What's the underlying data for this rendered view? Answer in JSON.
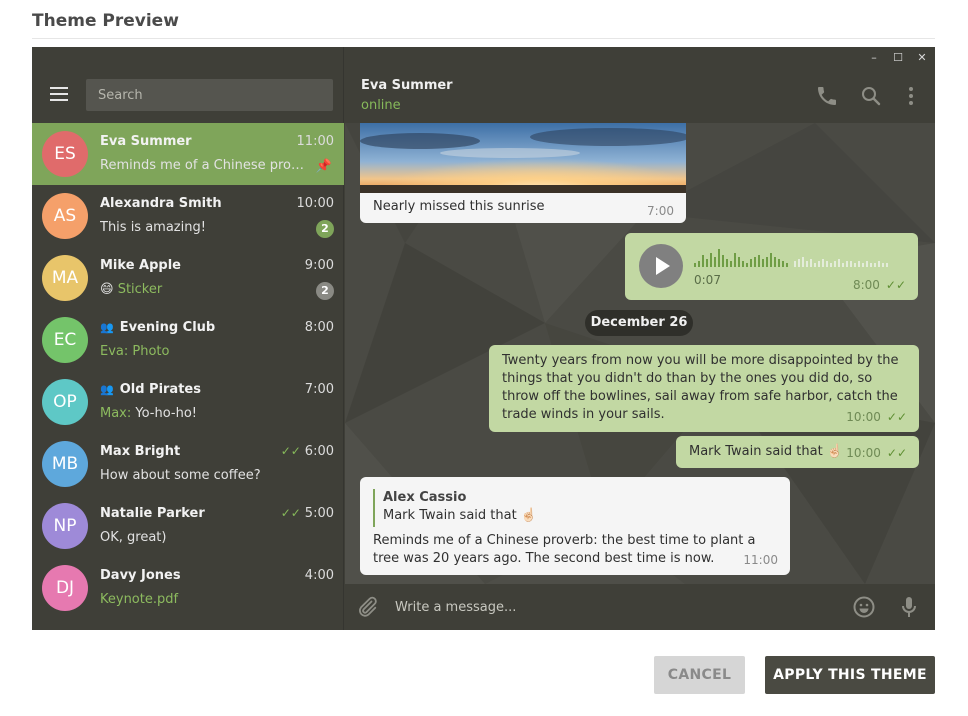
{
  "page": {
    "title": "Theme Preview"
  },
  "window_controls": {
    "minimize": "–",
    "maximize": "☐",
    "close": "✕"
  },
  "sidebar": {
    "search_placeholder": "Search",
    "chats": [
      {
        "initials": "ES",
        "name": "Eva Summer",
        "time": "11:00",
        "prefix": "",
        "message": "Reminds me of a Chinese prover...",
        "avatar_color": "#e06b6b",
        "pinned": true,
        "active": true
      },
      {
        "initials": "AS",
        "name": "Alexandra Smith",
        "time": "10:00",
        "prefix": "",
        "message": "This is amazing!",
        "avatar_color": "#f5a06a",
        "badge": "2",
        "badge_color": "#7fa55a"
      },
      {
        "initials": "MA",
        "name": "Mike Apple",
        "time": "9:00",
        "prefix": "😄 ",
        "message": "Sticker",
        "message_highlight": true,
        "avatar_color": "#e8c56a",
        "badge": "2",
        "badge_color": "#8a8a84"
      },
      {
        "initials": "EC",
        "name": "Evening Club",
        "group": true,
        "time": "8:00",
        "prefix": "",
        "message": "Eva: Photo",
        "message_highlight": true,
        "avatar_color": "#74c46a"
      },
      {
        "initials": "OP",
        "name": "Old Pirates",
        "group": true,
        "time": "7:00",
        "prefix": "Max: ",
        "message": "Yo-ho-ho!",
        "avatar_color": "#5ec8c6"
      },
      {
        "initials": "MB",
        "name": "Max Bright",
        "time": "6:00",
        "read": true,
        "prefix": "",
        "message": "How about some coffee?",
        "avatar_color": "#5ea8dc"
      },
      {
        "initials": "NP",
        "name": "Natalie Parker",
        "time": "5:00",
        "read": true,
        "prefix": "",
        "message": "OK, great)",
        "avatar_color": "#9e8ad8"
      },
      {
        "initials": "DJ",
        "name": "Davy Jones",
        "time": "4:00",
        "prefix": "",
        "message": "Keynote.pdf",
        "message_highlight": true,
        "avatar_color": "#e679b0"
      }
    ]
  },
  "chat": {
    "header": {
      "name": "Eva Summer",
      "status": "online"
    },
    "messages": {
      "photo_caption": "Nearly missed this sunrise",
      "photo_time": "7:00",
      "voice_duration": "0:07",
      "voice_time": "8:00",
      "date_separator": "December 26",
      "long_text": "Twenty years from now you will be more disappointed by the things that you didn't do than by the ones you did do, so throw off the bowlines, sail away from safe harbor, catch the trade winds in your sails.",
      "long_time": "10:00",
      "short_text": "Mark Twain said that ☝🏻",
      "short_time": "10:00",
      "reply_author": "Alex Cassio",
      "reply_quote": "Mark Twain said that ☝🏻",
      "reply_text": "Reminds me of a Chinese proverb: the best time to plant a tree was 20 years ago. The second best time is now.",
      "reply_time": "11:00"
    },
    "composer_placeholder": "Write a message..."
  },
  "buttons": {
    "cancel": "CANCEL",
    "apply": "APPLY THIS THEME"
  },
  "colors": {
    "accent": "#7fa55a",
    "panel": "#3f3f38",
    "outgoing": "#c2d8a3",
    "incoming": "#f5f5f5"
  }
}
